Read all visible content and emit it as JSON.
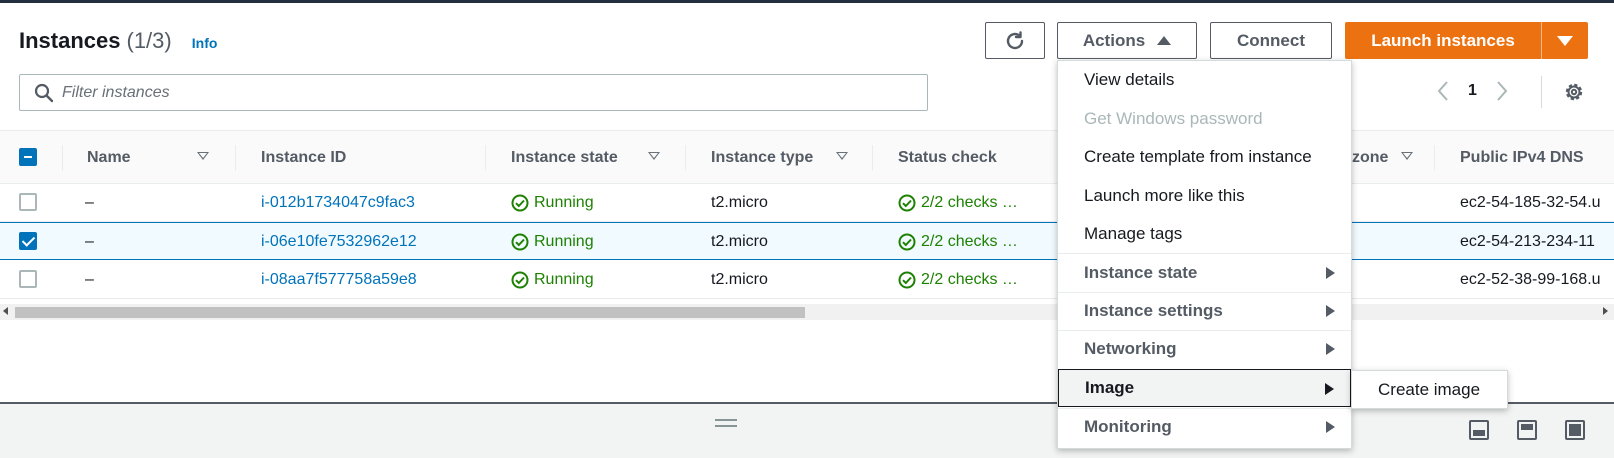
{
  "header": {
    "title": "Instances",
    "count": "(1/3)",
    "info": "Info"
  },
  "toolbar": {
    "refresh_icon": "refresh-icon",
    "actions_label": "Actions",
    "connect_label": "Connect",
    "launch_label": "Launch instances"
  },
  "search": {
    "placeholder": "Filter instances"
  },
  "pagination": {
    "current_page": "1"
  },
  "table": {
    "columns": [
      "Name",
      "Instance ID",
      "Instance state",
      "Instance type",
      "Status check",
      "zone",
      "Public IPv4 DNS"
    ],
    "rows": [
      {
        "name": "–",
        "instance_id": "i-012b1734047c9fac3",
        "state": "Running",
        "type": "t2.micro",
        "status": "2/2 checks …",
        "dns": "ec2-54-185-32-54.u",
        "selected": false
      },
      {
        "name": "–",
        "instance_id": "i-06e10fe7532962e12",
        "state": "Running",
        "type": "t2.micro",
        "status": "2/2 checks …",
        "dns": "ec2-54-213-234-11",
        "selected": true
      },
      {
        "name": "–",
        "instance_id": "i-08aa7f577758a59e8",
        "state": "Running",
        "type": "t2.micro",
        "status": "2/2 checks …",
        "dns": "ec2-52-38-99-168.u",
        "selected": false
      }
    ]
  },
  "actions_menu": {
    "items": [
      {
        "label": "View details"
      },
      {
        "label": "Get Windows password"
      },
      {
        "label": "Create template from instance"
      },
      {
        "label": "Launch more like this"
      },
      {
        "label": "Manage tags"
      },
      {
        "label": "Instance state"
      },
      {
        "label": "Instance settings"
      },
      {
        "label": "Networking"
      },
      {
        "label": "Image"
      },
      {
        "label": "Monitoring"
      }
    ],
    "submenu": {
      "label": "Create image"
    }
  },
  "colors": {
    "link": "#0073bb",
    "running": "#1d8102",
    "launch": "#ec7211"
  }
}
